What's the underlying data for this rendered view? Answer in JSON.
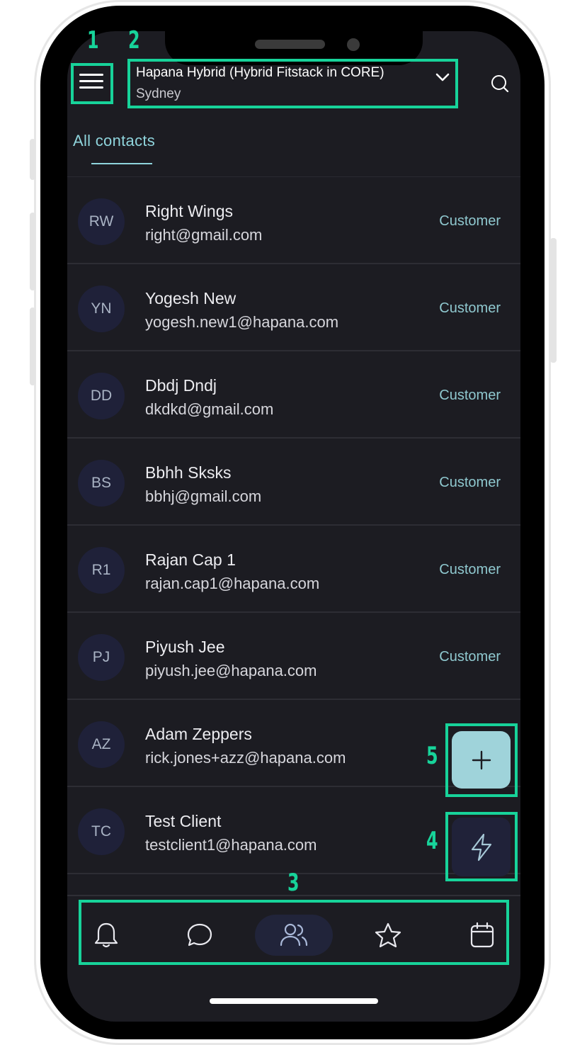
{
  "header": {
    "org_name": "Hapana Hybrid (Hybrid Fitstack in CORE)",
    "org_location": "Sydney",
    "menu_icon": "hamburger-menu-icon",
    "dropdown_icon": "chevron-down-icon",
    "search_icon": "search-icon"
  },
  "tabs": [
    {
      "label": "All contacts",
      "active": true
    }
  ],
  "contacts": [
    {
      "initials": "RW",
      "name": "Right Wings",
      "email": "right@gmail.com",
      "type": "Customer"
    },
    {
      "initials": "YN",
      "name": "Yogesh New",
      "email": "yogesh.new1@hapana.com",
      "type": "Customer"
    },
    {
      "initials": "DD",
      "name": "Dbdj Dndj",
      "email": "dkdkd@gmail.com",
      "type": "Customer"
    },
    {
      "initials": "BS",
      "name": "Bbhh Sksks",
      "email": "bbhj@gmail.com",
      "type": "Customer"
    },
    {
      "initials": "R1",
      "name": "Rajan Cap 1",
      "email": "rajan.cap1@hapana.com",
      "type": "Customer"
    },
    {
      "initials": "PJ",
      "name": "Piyush Jee",
      "email": "piyush.jee@hapana.com",
      "type": "Customer"
    },
    {
      "initials": "AZ",
      "name": "Adam Zeppers",
      "email": "rick.jones+azz@hapana.com",
      "type": ""
    },
    {
      "initials": "TC",
      "name": "Test Client",
      "email": "testclient1@hapana.com",
      "type": ""
    }
  ],
  "fabs": {
    "add_icon": "plus-icon",
    "quick_action_icon": "lightning-bolt-icon"
  },
  "bottom_nav": [
    {
      "icon": "bell-icon",
      "active": false
    },
    {
      "icon": "chat-bubble-icon",
      "active": false
    },
    {
      "icon": "contacts-icon",
      "active": true
    },
    {
      "icon": "star-icon",
      "active": false
    },
    {
      "icon": "calendar-icon",
      "active": false
    }
  ],
  "annotations": [
    "1",
    "2",
    "3",
    "4",
    "5"
  ],
  "colors": {
    "screen_bg": "#1c1c22",
    "accent": "#8fd4dc",
    "fab_add_bg": "#9fd3da",
    "annotation": "#17d39a"
  }
}
